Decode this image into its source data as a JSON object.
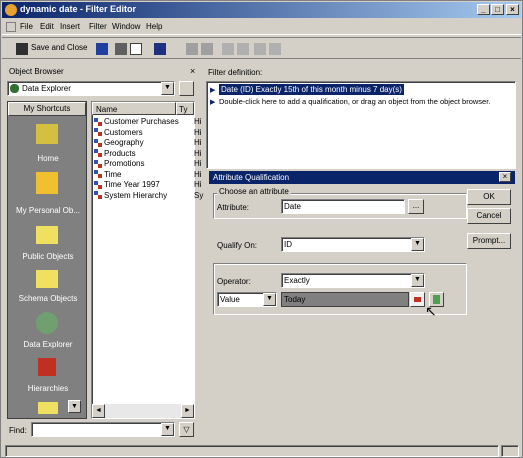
{
  "window": {
    "title": "dynamic date - Filter Editor"
  },
  "menu": [
    "File",
    "Edit",
    "Insert",
    "Filter",
    "Window",
    "Help"
  ],
  "toolbar": {
    "save_close": "Save and Close"
  },
  "object_browser": {
    "title": "Object Browser",
    "dropdown": "Data Explorer",
    "shortcuts_header": "My Shortcuts",
    "shortcuts": [
      "Home",
      "My Personal Ob...",
      "Public Objects",
      "Schema Objects",
      "Data Explorer",
      "Hierarchies"
    ],
    "list_headers": [
      "Name",
      "Ty"
    ],
    "items": [
      {
        "name": "Customer Purchases",
        "type": "Hi"
      },
      {
        "name": "Customers",
        "type": "Hi"
      },
      {
        "name": "Geography",
        "type": "Hi"
      },
      {
        "name": "Products",
        "type": "Hi"
      },
      {
        "name": "Promotions",
        "type": "Hi"
      },
      {
        "name": "Time",
        "type": "Hi"
      },
      {
        "name": "Time Year 1997",
        "type": "Hi"
      },
      {
        "name": "System Hierarchy",
        "type": "Sy"
      }
    ],
    "find_label": "Find:"
  },
  "filter_def": {
    "label": "Filter definition:",
    "line1": "Date (ID) Exactly 15th of this month minus 7 day(s)",
    "line2": "Double-click here to add a qualification, or drag an object from the object browser."
  },
  "dialog": {
    "title": "Attribute Qualification",
    "group": "Choose an attribute",
    "attribute_label": "Attribute:",
    "attribute_value": "Date",
    "browse": "...",
    "qualify_label": "Qualify On:",
    "qualify_value": "ID",
    "operator_label": "Operator:",
    "operator_value": "Exactly",
    "value_type": "Value",
    "value": "Today",
    "ok": "OK",
    "cancel": "Cancel",
    "prompt": "Prompt..."
  }
}
